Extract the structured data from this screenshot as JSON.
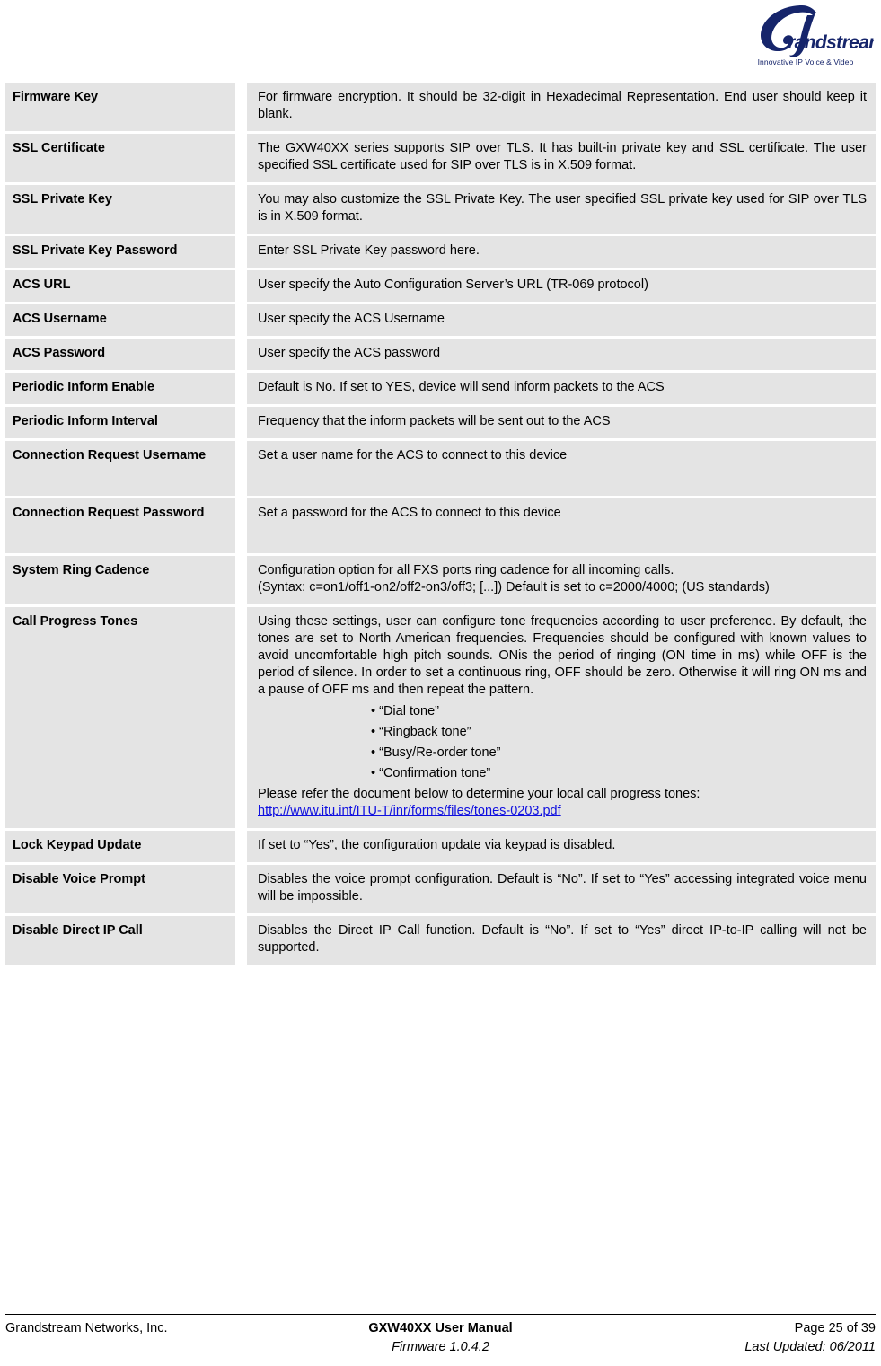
{
  "header": {
    "logo_text": "Grandstream",
    "logo_tagline": "Innovative IP Voice & Video",
    "logo_color": "#16256b"
  },
  "table": {
    "rows": [
      {
        "term": "Firmware Key",
        "paragraphs": [
          "For firmware encryption.  It should be 32-digit in Hexadecimal Representation.  End user should keep it blank."
        ]
      },
      {
        "term": "SSL Certificate",
        "paragraphs": [
          "The GXW40XX series supports SIP over TLS. It has built-in private key and SSL certificate. The user specified SSL certificate used for SIP over TLS is in X.509 format."
        ]
      },
      {
        "term": "SSL Private Key",
        "paragraphs": [
          "You may also customize the SSL Private Key. The user specified SSL private key used for SIP over TLS is in X.509 format."
        ]
      },
      {
        "term": "SSL Private Key Password",
        "paragraphs": [
          "Enter SSL Private Key password here."
        ]
      },
      {
        "term": "ACS URL",
        "paragraphs": [
          "User specify the Auto Configuration Server’s URL (TR-069 protocol)"
        ]
      },
      {
        "term": "ACS Username",
        "paragraphs": [
          "User specify the ACS Username"
        ]
      },
      {
        "term": "ACS Password",
        "paragraphs": [
          "User specify the ACS password"
        ]
      },
      {
        "term": "Periodic Inform Enable",
        "paragraphs": [
          "Default is No. If set to YES, device will send inform packets to the ACS"
        ]
      },
      {
        "term": "Periodic Inform Interval",
        "paragraphs": [
          "Frequency that the inform packets will be sent out to the ACS"
        ]
      },
      {
        "term": "Connection Request Username",
        "paragraphs": [
          "Set a user name for the ACS to connect to this device"
        ],
        "extra_height": 26
      },
      {
        "term": "Connection Request Password",
        "paragraphs": [
          "Set a password for the ACS to connect to this device"
        ],
        "extra_height": 26
      },
      {
        "term": "System Ring Cadence",
        "paragraphs": [
          "Configuration option for all FXS ports ring cadence for all incoming calls.",
          "(Syntax: c=on1/off1-on2/off2-on3/off3; [...]) Default is set to c=2000/4000; (US standards)"
        ]
      },
      {
        "term": "Call Progress Tones",
        "paragraphs": [
          "Using these settings, user can configure tone frequencies according to user preference. By default, the tones are set to North American frequencies. Frequencies should be configured with known values to avoid uncomfortable high pitch sounds. ONis the period of ringing (ON time in ms) while OFF is the period of silence. In order to set a continuous ring, OFF should be zero. Otherwise it will ring ON ms and a pause of OFF ms and then repeat the pattern."
        ],
        "bullets": [
          "“Dial tone”",
          "“Ringback tone”",
          "“Busy/Re-order tone”",
          "“Confirmation tone”"
        ],
        "trailing_paragraphs": [
          "Please refer the document below to determine your local call progress tones:"
        ],
        "link": {
          "text": "http://www.itu.int/ITU-T/inr/forms/files/tones-0203.pdf",
          "color": "#1010e0"
        }
      },
      {
        "term": "Lock Keypad Update",
        "paragraphs": [
          "If set to “Yes”, the configuration update via keypad is disabled."
        ]
      },
      {
        "term": "Disable Voice Prompt",
        "paragraphs": [
          "Disables the voice prompt configuration.  Default is “No”. If set to “Yes” accessing integrated voice menu will be impossible."
        ]
      },
      {
        "term": "Disable Direct IP Call",
        "paragraphs": [
          "Disables the Direct IP Call function.  Default is “No”.  If set to “Yes” direct IP-to-IP calling will not be supported."
        ]
      }
    ]
  },
  "footer": {
    "left": "Grandstream Networks, Inc.",
    "center_line1": "GXW40XX User Manual",
    "center_line2": "Firmware 1.0.4.2",
    "right_line1": "Page 25 of 39",
    "right_line2": "Last Updated:  06/2011"
  }
}
